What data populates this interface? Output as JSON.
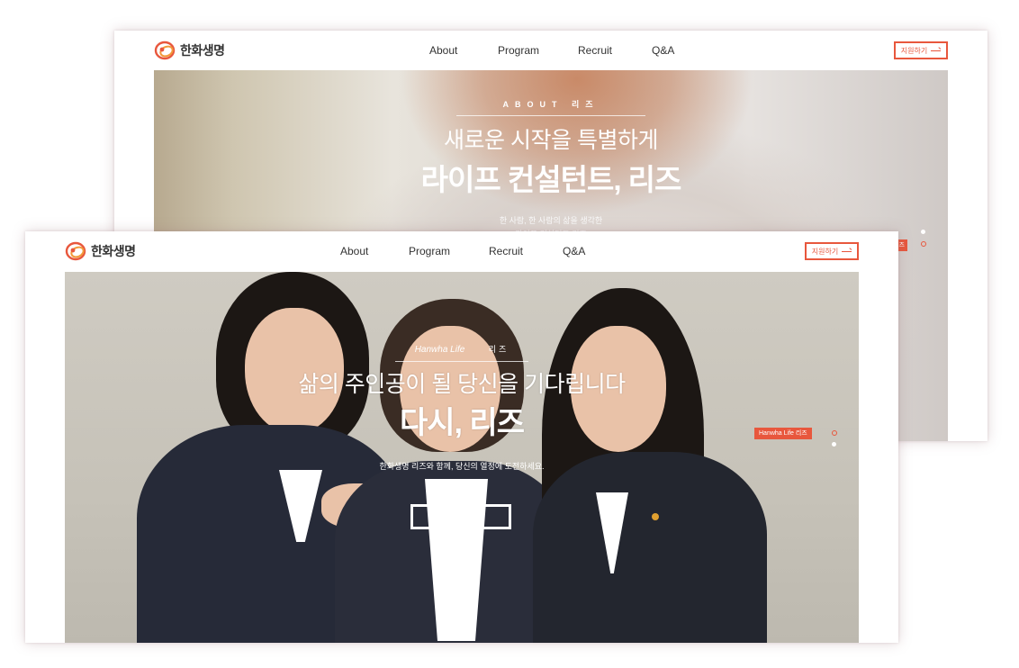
{
  "brand": {
    "name": "한화생명",
    "accent": "#e8573d",
    "logo_icon": "hanwha-logo-icon"
  },
  "nav": {
    "items": [
      "About",
      "Program",
      "Recruit",
      "Q&A"
    ],
    "apply_label": "지원하기"
  },
  "back_page": {
    "eyebrow": "ABOUT  리즈",
    "headline_light": "새로운 시작을 특별하게",
    "headline_bold": "라이프 컨설턴트, 리즈",
    "body": "한 사람, 한 사람의 삶을 생각한",
    "body_cut": "라이프 컨설턴트 리즈",
    "tag": "리즈"
  },
  "front_page": {
    "eyebrow_left": "Hanwha Life",
    "eyebrow_right": "리즈",
    "headline_light": "삶의 주인공이 될 당신을 기다립니다",
    "headline_bold": "다시, 리즈",
    "body": "한화생명 리즈와 함께, 당신의 열정에 도전하세요.",
    "cta_label": "지원하기",
    "tag": "Hanwha Life 리즈",
    "scroll_icon": "chevron-double-down-icon"
  }
}
